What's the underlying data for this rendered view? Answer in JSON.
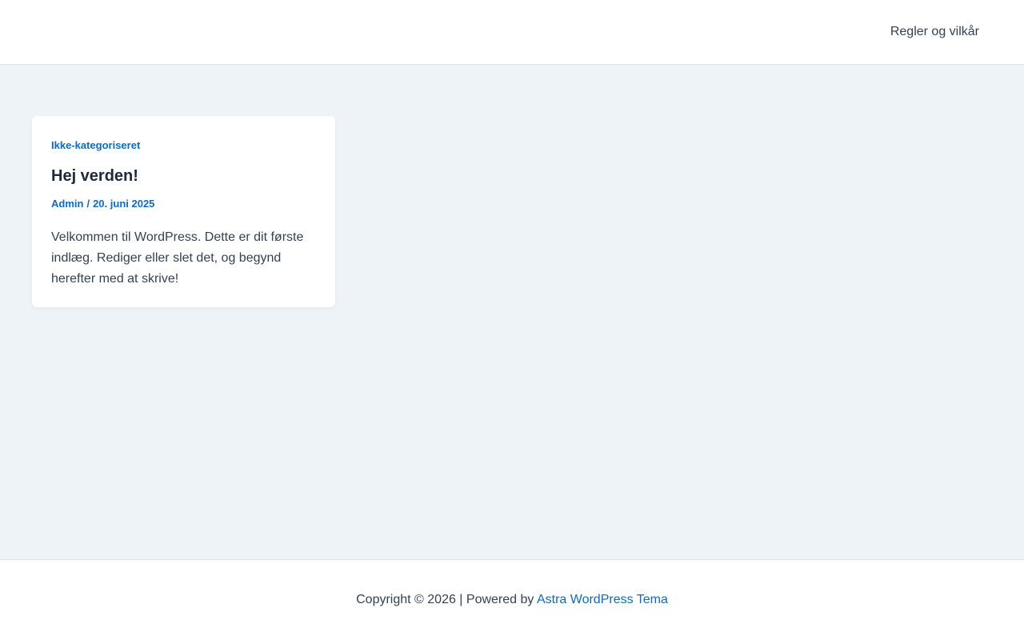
{
  "header": {
    "nav_items": [
      {
        "label": "Regler og vilkår"
      }
    ]
  },
  "post": {
    "category": "Ikke-kategoriseret",
    "title": "Hej verden!",
    "author": "Admin",
    "separator": "/",
    "date": "20. juni 2025",
    "excerpt": "Velkommen til WordPress. Dette er dit første indlæg. Rediger eller slet det, og begynd herefter med at skrive!"
  },
  "footer": {
    "copyright_text": "Copyright © 2026 | Powered by ",
    "theme_link": "Astra WordPress Tema"
  },
  "colors": {
    "accent": "#0b6bc7",
    "content_background": "#eef3f8",
    "text": "#334155",
    "heading": "#1e293b"
  }
}
